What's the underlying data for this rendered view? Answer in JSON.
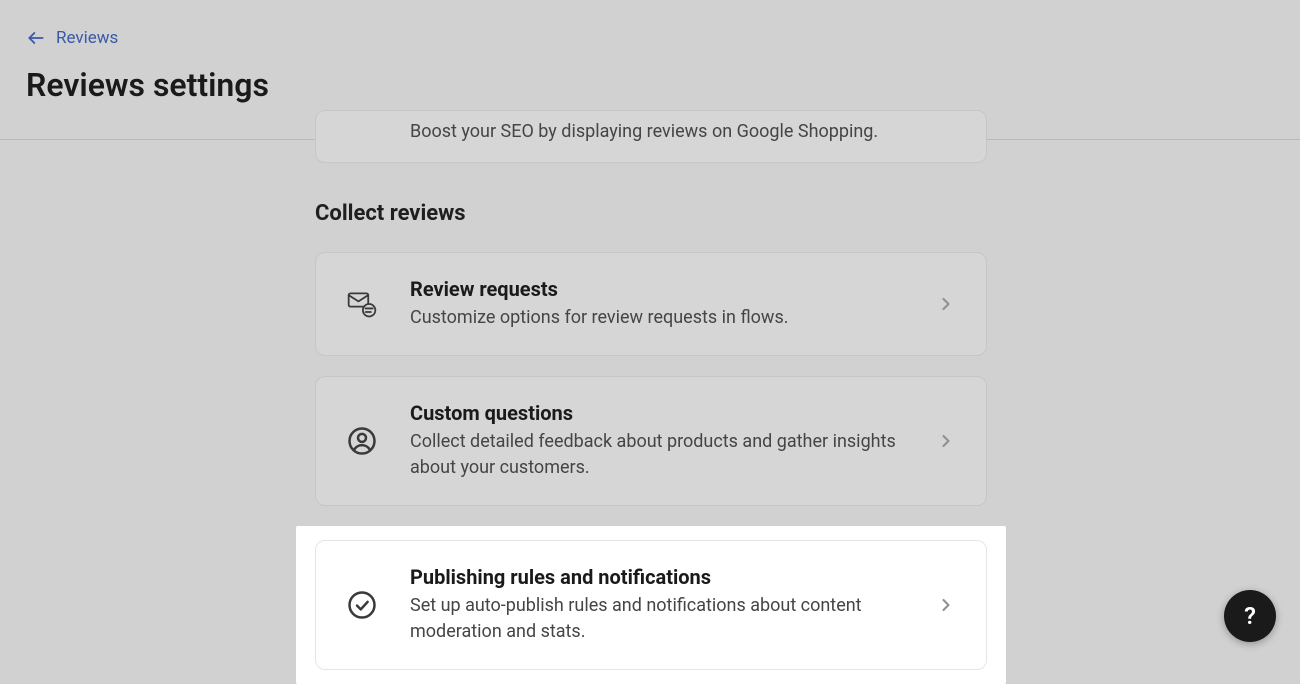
{
  "header": {
    "back_label": "Reviews",
    "page_title": "Reviews settings"
  },
  "partial_card": {
    "desc": "Boost your SEO by displaying reviews on Google Shopping."
  },
  "section": {
    "title": "Collect reviews"
  },
  "cards": {
    "review_requests": {
      "title": "Review requests",
      "desc": "Customize options for review requests in flows."
    },
    "custom_questions": {
      "title": "Custom questions",
      "desc": "Collect detailed feedback about products and gather insights about your customers."
    },
    "publishing": {
      "title": "Publishing rules and notifications",
      "desc": "Set up auto-publish rules and notifications about content moderation and stats."
    }
  },
  "help": {
    "label": "?"
  }
}
